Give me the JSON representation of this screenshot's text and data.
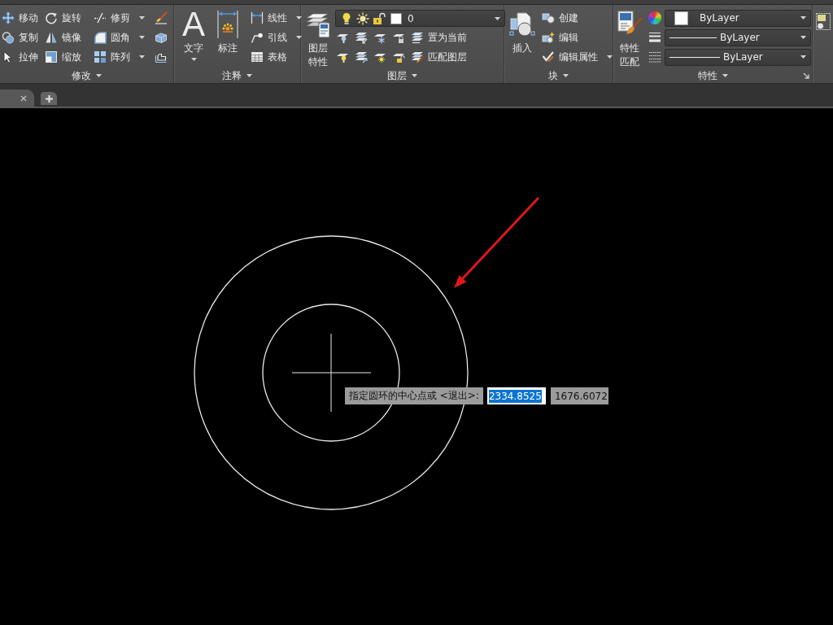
{
  "ribbon": {
    "modify": {
      "title": "修改",
      "tools": [
        {
          "label": "移动",
          "has_menu": false
        },
        {
          "label": "复制",
          "has_menu": false
        },
        {
          "label": "拉伸",
          "has_menu": false
        },
        {
          "label": "旋转",
          "has_menu": false
        },
        {
          "label": "镜像",
          "has_menu": false
        },
        {
          "label": "缩放",
          "has_menu": false
        },
        {
          "label": "修剪",
          "has_menu": true
        },
        {
          "label": "圆角",
          "has_menu": true
        },
        {
          "label": "阵列",
          "has_menu": true
        }
      ]
    },
    "annotation": {
      "title": "注释",
      "large_tools": [
        {
          "glyph": "A",
          "label": "文字",
          "has_menu": true
        },
        {
          "label": "标注",
          "has_menu": false
        }
      ],
      "tools": [
        {
          "label": "线性",
          "has_menu": true
        },
        {
          "label": "引线",
          "has_menu": true
        },
        {
          "label": "表格",
          "has_menu": false
        }
      ]
    },
    "layers": {
      "title": "图层",
      "large_tool": {
        "label": "图层特性"
      },
      "current_layer": "0",
      "tools": [
        {
          "label": "置为当前"
        },
        {
          "label": "匹配图层"
        }
      ]
    },
    "block": {
      "title": "块",
      "large_tool": {
        "label": "插入"
      },
      "tools": [
        {
          "label": "创建",
          "has_menu": false
        },
        {
          "label": "编辑",
          "has_menu": false
        },
        {
          "label": "编辑属性",
          "has_menu": true
        }
      ]
    },
    "properties": {
      "title": "特性",
      "large_tool": {
        "label": "特性匹配"
      },
      "dropdowns": [
        {
          "kind": "color",
          "value": "ByLayer"
        },
        {
          "kind": "lineweight",
          "value": "ByLayer"
        },
        {
          "kind": "linetype",
          "value": "ByLayer"
        }
      ]
    }
  },
  "canvas": {
    "prompt": {
      "text": "指定圆环的中心点或 <退出>:",
      "x_value": "2334.8525",
      "x_highlighted": true,
      "y_value": "1676.6072"
    }
  }
}
